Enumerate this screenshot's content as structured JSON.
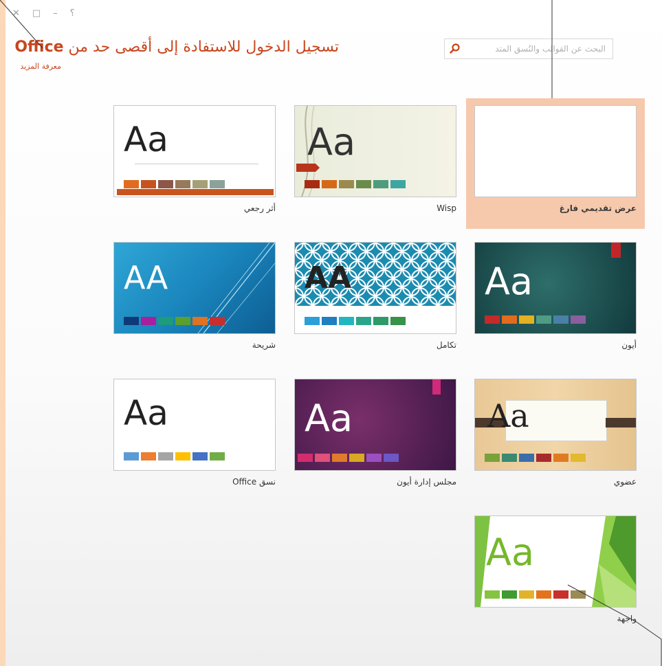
{
  "window": {
    "close": "✕",
    "restore": "□",
    "minimize": "–",
    "help": "؟"
  },
  "header": {
    "title": "تسجيل الدخول للاستفادة إلى أقصى حد من",
    "title_brand": "Office",
    "learn_more": "معرفة المزيد",
    "search_placeholder": "البحث عن القوالب والنُسق المتد"
  },
  "templates": [
    {
      "label": "عرض تقديمي فارغ",
      "selected": true
    },
    {
      "label": "Wisp"
    },
    {
      "label": "أثر رجعي"
    },
    {
      "label": "أيون"
    },
    {
      "label": "تكامل"
    },
    {
      "label": "شريحة"
    },
    {
      "label": "عضوي"
    },
    {
      "label": "مجلس إدارة أيون"
    },
    {
      "label": "نسق Office"
    },
    {
      "label": "واجهة"
    }
  ],
  "thumb_text": {
    "aa_lower": "Aa",
    "aa_upper": "AA"
  },
  "colors": {
    "accent": "#c8461d",
    "selected_bg": "#f6c9ad"
  }
}
